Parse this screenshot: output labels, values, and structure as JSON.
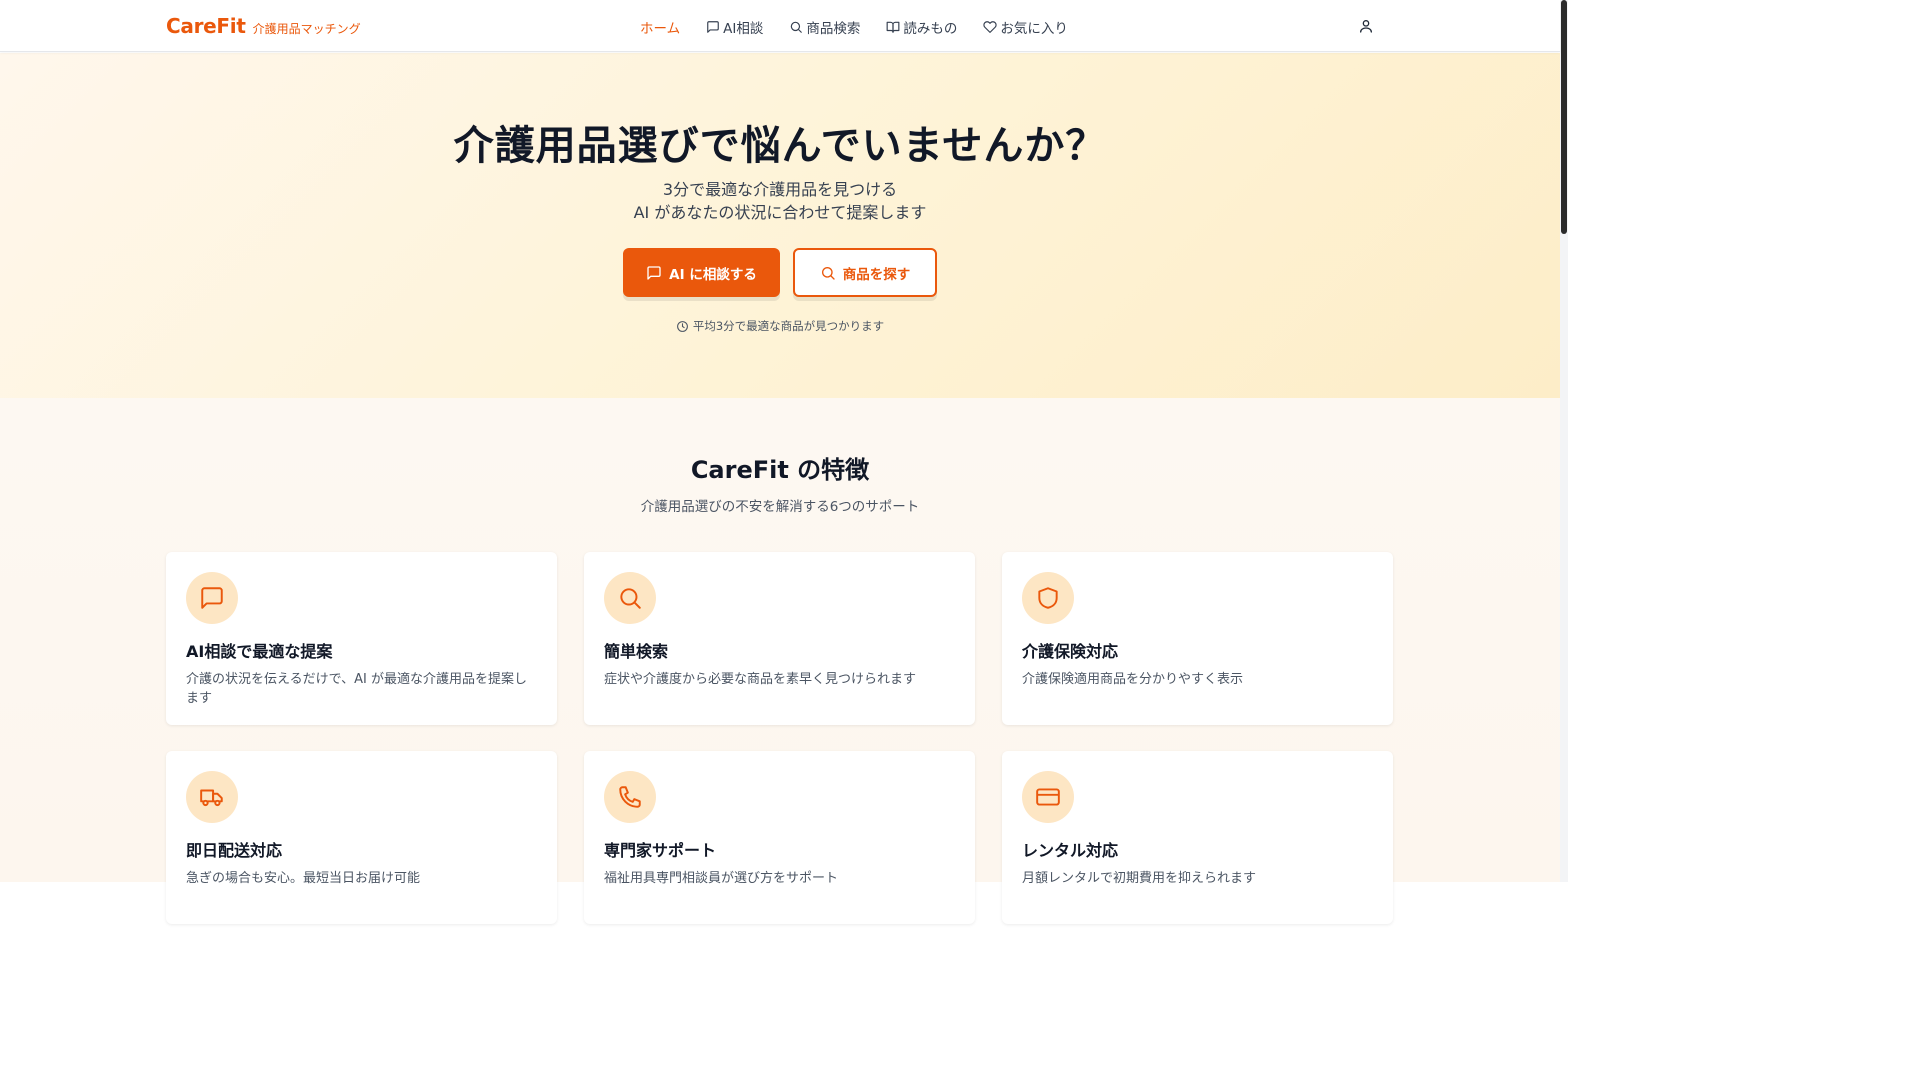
{
  "header": {
    "brand_name": "CareFit",
    "brand_tagline": "介護用品マッチング",
    "nav": [
      {
        "label": "ホーム",
        "icon": "none",
        "active": true
      },
      {
        "label": "AI相談",
        "icon": "chat-icon",
        "active": false
      },
      {
        "label": "商品検索",
        "icon": "search-icon",
        "active": false
      },
      {
        "label": "読みもの",
        "icon": "book-icon",
        "active": false
      },
      {
        "label": "お気に入り",
        "icon": "heart-icon",
        "active": false
      }
    ],
    "user_icon": "user-icon"
  },
  "hero": {
    "title": "介護用品選びで悩んでいませんか？",
    "subtitle_line1": "3分で最適な介護用品を見つける",
    "subtitle_line2": "AI があなたの状況に合わせて提案します",
    "primary_button": "AI に相談する",
    "secondary_button": "商品を探す",
    "note": "平均3分で最適な商品が見つかります"
  },
  "features": {
    "title": "CareFit の特徴",
    "subtitle": "介護用品選びの不安を解消する6つのサポート",
    "cards": [
      {
        "icon": "chat-icon",
        "title": "AI相談で最適な提案",
        "desc": "介護の状況を伝えるだけで、AI が最適な介護用品を提案します"
      },
      {
        "icon": "search-icon",
        "title": "簡単検索",
        "desc": "症状や介護度から必要な商品を素早く見つけられます"
      },
      {
        "icon": "shield-icon",
        "title": "介護保険対応",
        "desc": "介護保険適用商品を分かりやすく表示"
      },
      {
        "icon": "truck-icon",
        "title": "即日配送対応",
        "desc": "急ぎの場合も安心。最短当日お届け可能"
      },
      {
        "icon": "phone-icon",
        "title": "専門家サポート",
        "desc": "福祉用具専門相談員が選び方をサポート"
      },
      {
        "icon": "credit-card-icon",
        "title": "レンタル対応",
        "desc": "月額レンタルで初期費用を抑えられます"
      }
    ]
  },
  "colors": {
    "accent": "#ea580c",
    "icon_bg": "#fde6c4",
    "hero_bg": "#fef3d6"
  }
}
